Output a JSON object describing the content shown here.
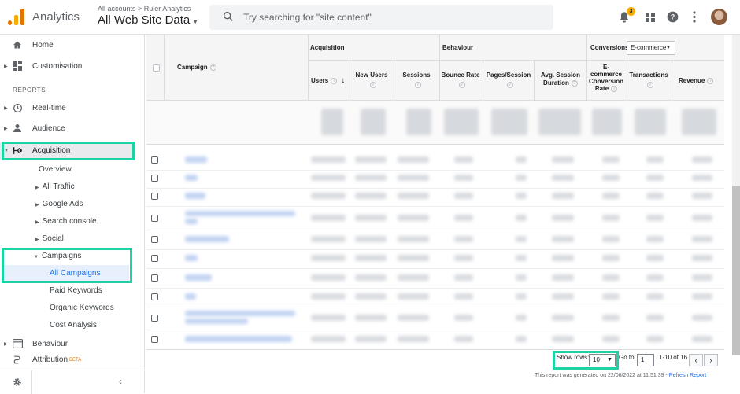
{
  "topbar": {
    "app_name": "Analytics",
    "breadcrumb": "All accounts > Ruler Analytics",
    "property": "All Web Site Data",
    "search_placeholder": "Try searching for \"site content\"",
    "notification_count": "3"
  },
  "sidebar": {
    "home": "Home",
    "customisation": "Customisation",
    "reports_heading": "REPORTS",
    "realtime": "Real-time",
    "audience": "Audience",
    "acquisition": "Acquisition",
    "acq_items": {
      "overview": "Overview",
      "all_traffic": "All Traffic",
      "google_ads": "Google Ads",
      "search_console": "Search console",
      "social": "Social",
      "campaigns": "Campaigns"
    },
    "campaign_items": {
      "all_campaigns": "All Campaigns",
      "paid_keywords": "Paid Keywords",
      "organic_keywords": "Organic Keywords",
      "cost_analysis": "Cost Analysis"
    },
    "behaviour": "Behaviour",
    "attribution": "Attribution",
    "attribution_badge": "BETA"
  },
  "table": {
    "campaign_header": "Campaign",
    "group_acquisition": "Acquisition",
    "group_behaviour": "Behaviour",
    "group_conversions": "Conversions",
    "conversions_select": "E-commerce",
    "cols": {
      "users": "Users",
      "new_users": "New Users",
      "sessions": "Sessions",
      "bounce_rate": "Bounce Rate",
      "pages_session": "Pages/Session",
      "avg_session_1": "Avg. Session",
      "avg_session_2": "Duration",
      "ecom_1": "E-",
      "ecom_2": "commerce",
      "ecom_3": "Conversion",
      "ecom_4": "Rate",
      "transactions": "Transactions",
      "revenue": "Revenue"
    }
  },
  "footer": {
    "show_rows_label": "Show rows:",
    "show_rows_value": "10",
    "goto_label": "Go to:",
    "goto_value": "1",
    "range": "1-10 of 16",
    "generated": "This report was generated on 22/06/2022 at 11:51:39 - ",
    "refresh": "Refresh Report"
  },
  "colors": {
    "highlight": "#1ed2a3",
    "link": "#1a73e8",
    "logo_orange": "#f9ab00",
    "logo_dark": "#e37400"
  }
}
